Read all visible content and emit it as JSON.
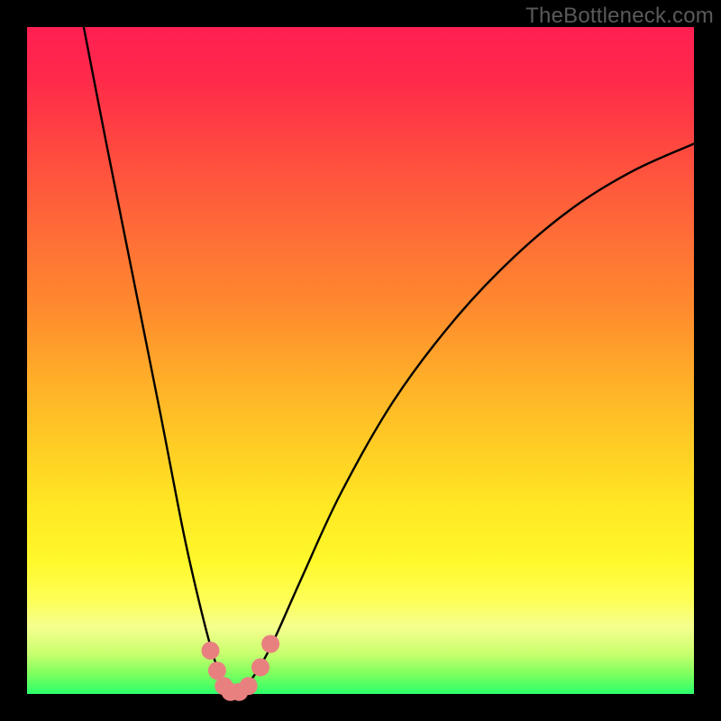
{
  "watermark": "TheBottleneck.com",
  "chart_data": {
    "type": "line",
    "title": "",
    "xlabel": "",
    "ylabel": "",
    "xlim": [
      0,
      1
    ],
    "ylim": [
      0,
      1
    ],
    "series": [
      {
        "name": "curve",
        "x": [
          0.085,
          0.12,
          0.16,
          0.2,
          0.235,
          0.26,
          0.28,
          0.295,
          0.305,
          0.315,
          0.335,
          0.365,
          0.41,
          0.47,
          0.55,
          0.64,
          0.73,
          0.82,
          0.91,
          1.0
        ],
        "y": [
          1.0,
          0.82,
          0.62,
          0.42,
          0.24,
          0.13,
          0.055,
          0.018,
          0.005,
          0.005,
          0.02,
          0.07,
          0.17,
          0.3,
          0.44,
          0.56,
          0.655,
          0.73,
          0.785,
          0.825
        ]
      }
    ],
    "markers": [
      {
        "x": 0.275,
        "y": 0.065
      },
      {
        "x": 0.285,
        "y": 0.035
      },
      {
        "x": 0.295,
        "y": 0.012
      },
      {
        "x": 0.305,
        "y": 0.003
      },
      {
        "x": 0.318,
        "y": 0.003
      },
      {
        "x": 0.332,
        "y": 0.012
      },
      {
        "x": 0.35,
        "y": 0.04
      },
      {
        "x": 0.365,
        "y": 0.075
      }
    ],
    "background": "rainbow-gradient-vertical"
  }
}
